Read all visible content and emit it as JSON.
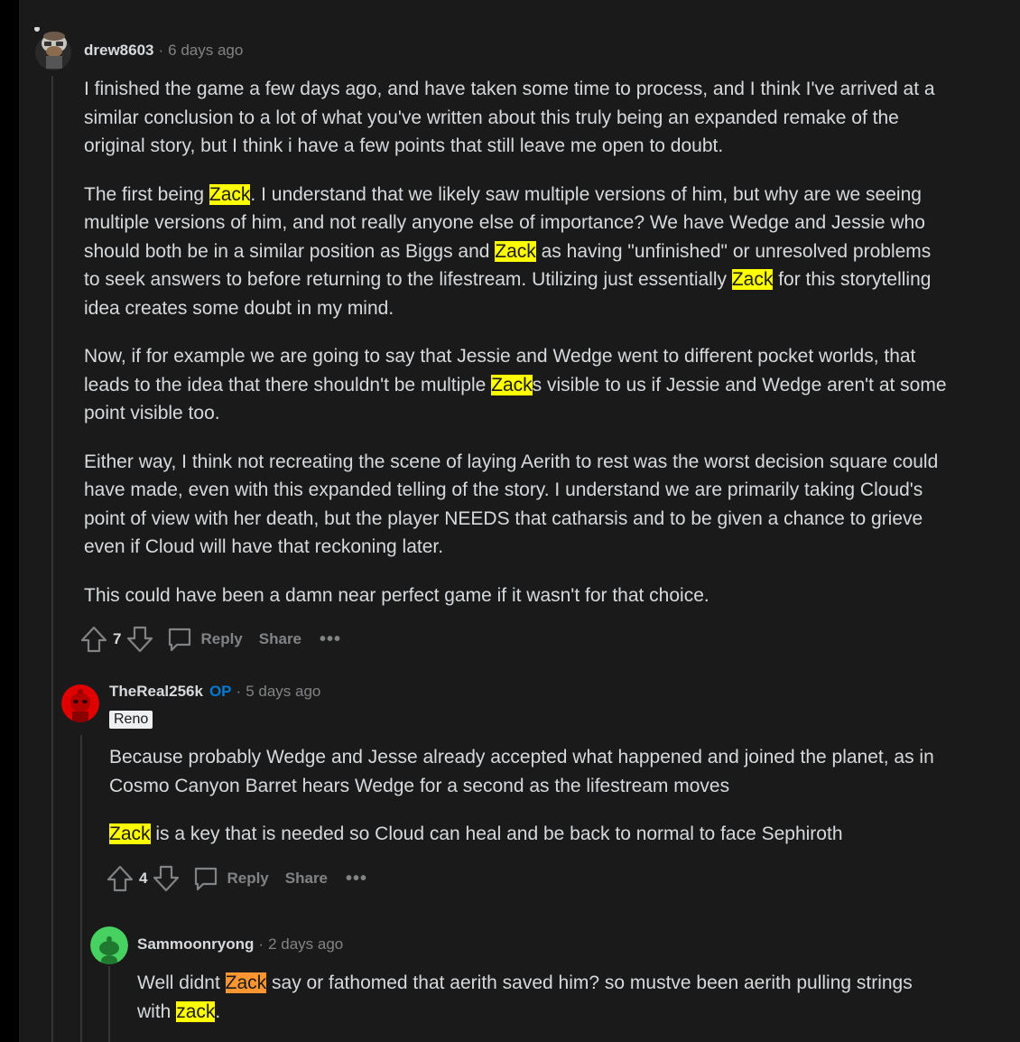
{
  "comment1": {
    "user": "drew8603",
    "time": "6 days ago",
    "p1": "I finished the game a few days ago, and have taken some time to process, and I think I've arrived at a similar conclusion to a lot of what you've written about this truly being an expanded remake of the original story, but I think i have a few points that still leave me open to doubt.",
    "p2": {
      "a": "The first being ",
      "hl1": "Zack",
      "b": ". I understand that we likely saw multiple versions of him, but why are we seeing multiple versions of him, and not really anyone else of importance? We have Wedge and Jessie who should both be in a similar position as Biggs and ",
      "hl2": "Zack",
      "c": " as having \"unfinished\" or unresolved problems to seek answers to before returning to the lifestream. Utilizing just essentially ",
      "hl3": "Zack",
      "d": " for this storytelling idea creates some doubt in my mind."
    },
    "p3": {
      "a": "Now, if for example we are going to say that Jessie and Wedge went to different pocket worlds, that leads to the idea that there shouldn't be multiple ",
      "hl1": "Zack",
      "b": "s visible to us if Jessie and Wedge aren't at some point visible too."
    },
    "p4": "Either way, I think not recreating the scene of laying Aerith to rest was the worst decision square could have made, even with this expanded telling of the story. I understand we are primarily taking Cloud's point of view with her death, but the player NEEDS that catharsis and to be given a chance to grieve even if Cloud will have that reckoning later.",
    "p5": "This could have been a damn near perfect game if it wasn't for that choice.",
    "votes": "7",
    "reply": "Reply",
    "share": "Share",
    "more": "•••"
  },
  "comment2": {
    "user": "TheReal256k",
    "op": "OP",
    "time": "5 days ago",
    "flair": "Reno",
    "p1": "Because probably Wedge and Jesse already accepted what happened and joined the planet, as in Cosmo Canyon Barret hears Wedge for a second as the lifestream moves",
    "p2": {
      "hl1": "Zack",
      "a": " is a key that is needed so Cloud can heal and be back to normal to face Sephiroth"
    },
    "votes": "4",
    "reply": "Reply",
    "share": "Share",
    "more": "•••"
  },
  "comment3": {
    "user": "Sammoonryong",
    "time": "2 days ago",
    "p1": {
      "a": "Well didnt ",
      "hl1": "Zack",
      "b": " say or fathomed that aerith saved him? so mustve been aerith pulling strings with ",
      "hl2": "zack",
      "c": "."
    }
  },
  "colors": {
    "background": "#1a1a1b",
    "highlight": "#ffff00",
    "highlight_current": "#ff9632",
    "op": "#0079d3",
    "muted": "#818384"
  }
}
